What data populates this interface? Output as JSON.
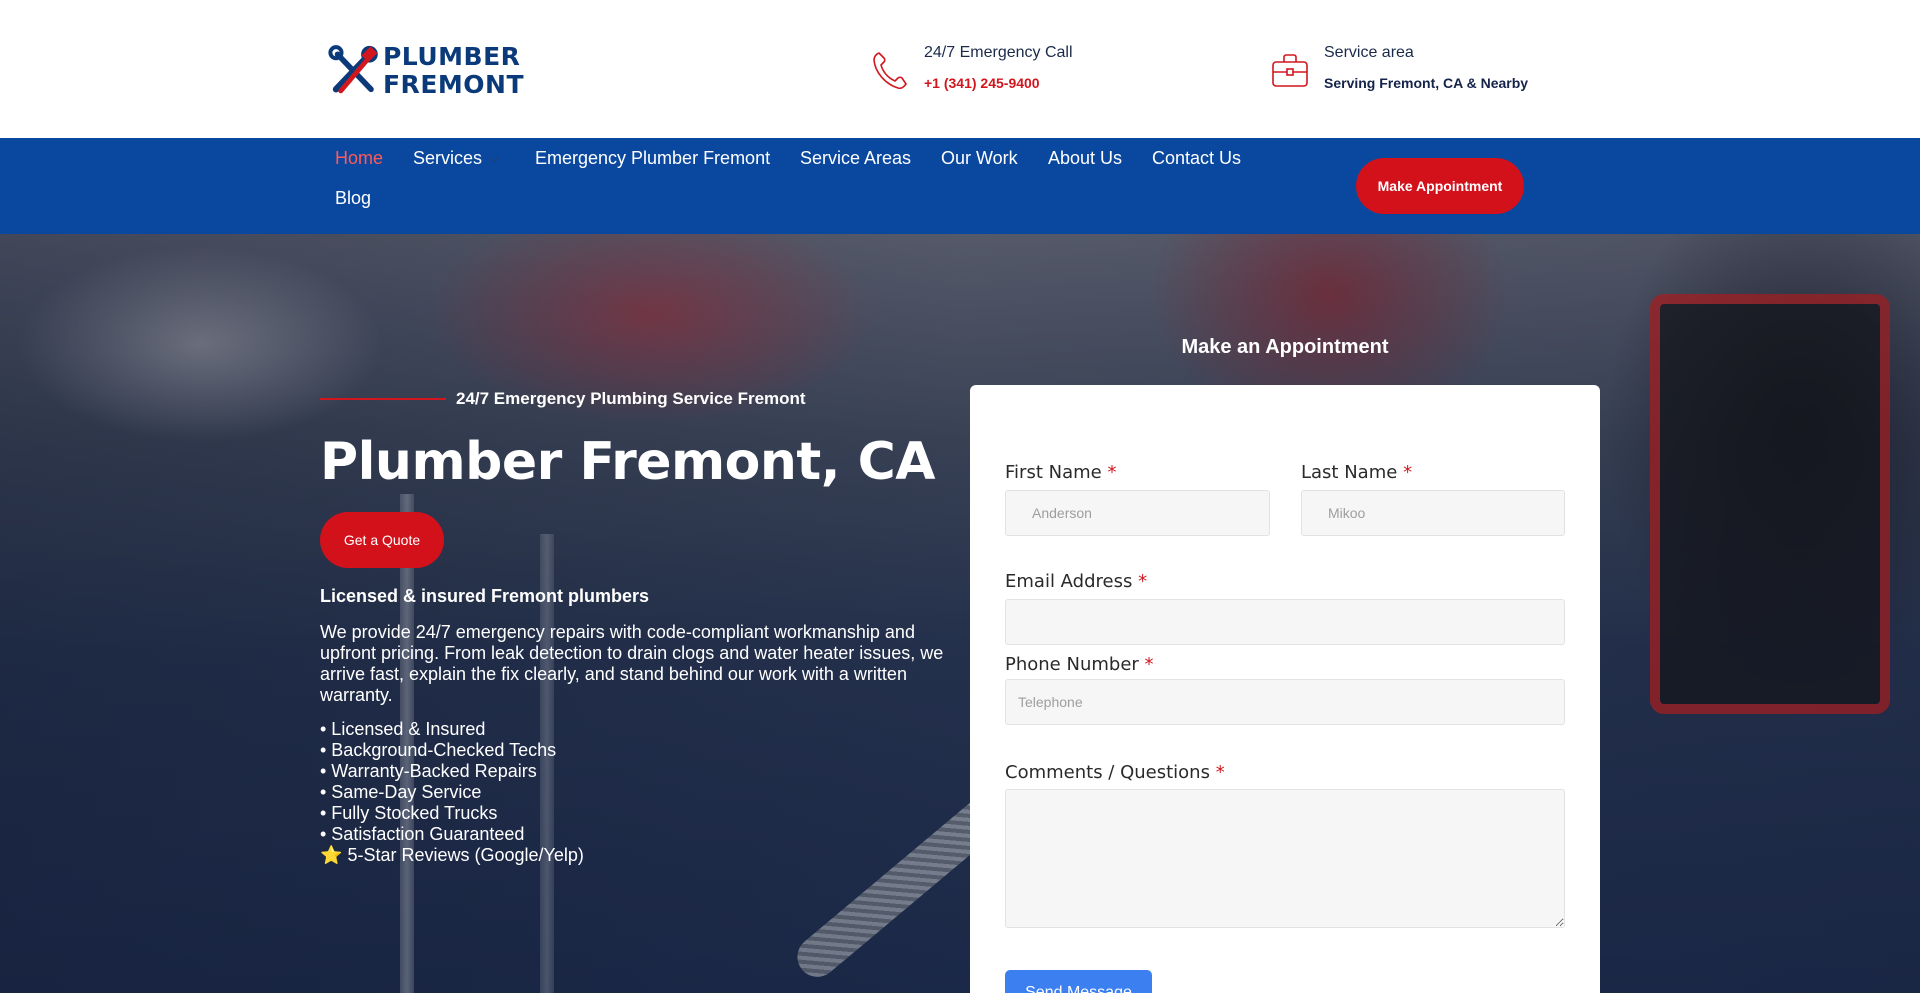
{
  "brand": {
    "logo_line1": "PLUMBER",
    "logo_line2": "FREMONT",
    "primary_color": "#0a48a0",
    "accent_color": "#d2111b"
  },
  "header": {
    "call": {
      "icon": "phone-icon",
      "title": "24/7 Emergency Call",
      "phone": "+1 (341) 245-9400"
    },
    "area": {
      "icon": "briefcase-icon",
      "title": "Service area",
      "value": "Serving Fremont, CA & Nearby"
    }
  },
  "nav": {
    "items": [
      {
        "label": "Home",
        "active": true
      },
      {
        "label": "Services",
        "has_dropdown": true
      },
      {
        "label": "Emergency Plumber Fremont"
      },
      {
        "label": "Service Areas"
      },
      {
        "label": "Our Work"
      },
      {
        "label": "About Us"
      },
      {
        "label": "Contact Us"
      },
      {
        "label": "Blog"
      }
    ],
    "cta": "Make Appointment"
  },
  "hero": {
    "eyebrow": "24/7 Emergency Plumbing Service Fremont",
    "title": "Plumber Fremont, CA",
    "cta": "Get a Quote",
    "subheading": "Licensed & insured Fremont plumbers",
    "description": "We provide 24/7 emergency repairs with code-compliant workmanship and upfront pricing. From leak detection to drain clogs and water heater issues, we arrive fast, explain the fix clearly, and stand behind our work with a written warranty.",
    "bullets": [
      "• Licensed & Insured",
      "• Background-Checked Techs",
      "• Warranty-Backed Repairs",
      "• Same-Day Service",
      "• Fully Stocked Trucks",
      "• Satisfaction Guaranteed"
    ],
    "review_icon": "star-icon",
    "review_star": "⭐",
    "review_text": "5-Star Reviews (Google/Yelp)"
  },
  "form": {
    "heading": "Make an Appointment",
    "required_mark": "*",
    "first_name": {
      "label": "First Name",
      "placeholder": "Anderson"
    },
    "last_name": {
      "label": "Last Name",
      "placeholder": "Mikoo"
    },
    "email": {
      "label": "Email Address",
      "placeholder": ""
    },
    "phone": {
      "label": "Phone Number",
      "placeholder": "Telephone"
    },
    "comments": {
      "label": "Comments / Questions",
      "placeholder": ""
    },
    "submit": "Send Message"
  }
}
